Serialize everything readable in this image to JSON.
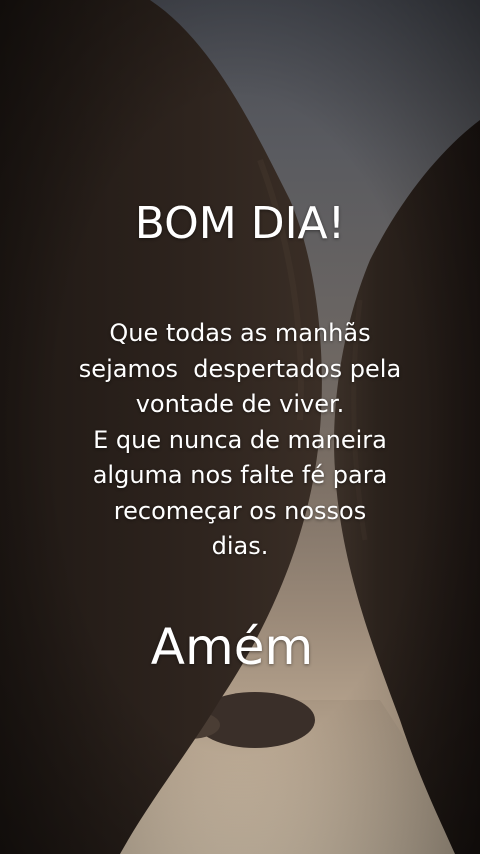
{
  "title": "BOM DIA!",
  "message": "Que todas as manhãs\nsejamos  despertados pela\nvontade de viver.\nE que nunca de maneira\nalguma nos falte fé para\nrecomeçar os nossos\ndias.",
  "closing": "Amém",
  "colors": {
    "text": "#ffffff",
    "sky": "#5a5b60",
    "rock": "#2a211c",
    "sand": "#c9b8a2"
  }
}
